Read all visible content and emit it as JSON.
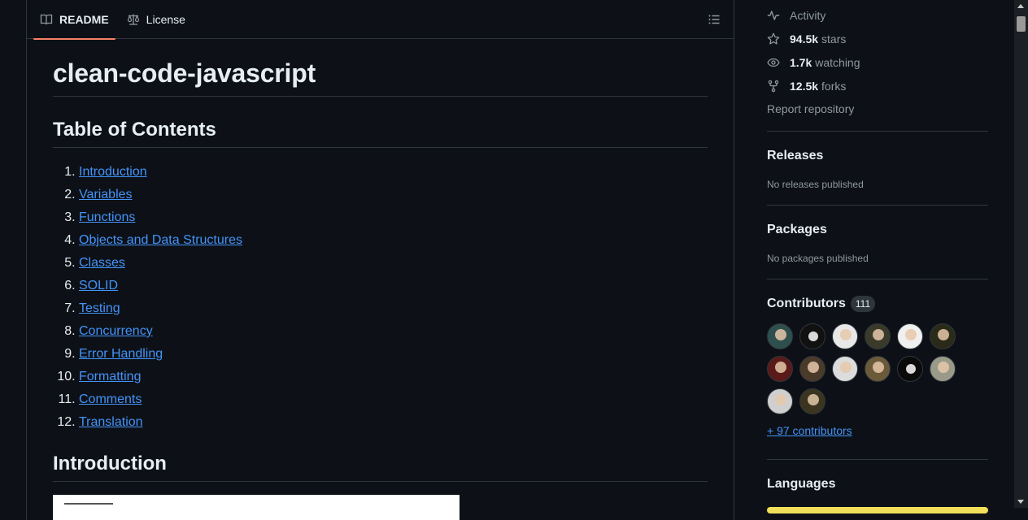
{
  "colors": {
    "background": "#0d1117",
    "border": "#30363d",
    "link": "#4493f8",
    "muted": "#9198a1",
    "active_tab_underline": "#f78166",
    "language_bar": "#f1e05a"
  },
  "readme": {
    "tabs": [
      {
        "label": "README",
        "icon": "book-icon",
        "active": true
      },
      {
        "label": "License",
        "icon": "law-icon",
        "active": false
      }
    ],
    "outline_icon": "list-unordered-icon",
    "title": "clean-code-javascript",
    "toc_heading": "Table of Contents",
    "toc": [
      "Introduction",
      "Variables",
      "Functions",
      "Objects and Data Structures",
      "Classes",
      "SOLID",
      "Testing",
      "Concurrency",
      "Error Handling",
      "Formatting",
      "Comments",
      "Translation"
    ],
    "intro_heading": "Introduction"
  },
  "sidebar": {
    "stats": [
      {
        "icon": "pulse-icon",
        "value": "",
        "label": "Activity"
      },
      {
        "icon": "star-icon",
        "value": "94.5k",
        "label": "stars"
      },
      {
        "icon": "eye-icon",
        "value": "1.7k",
        "label": "watching"
      },
      {
        "icon": "fork-icon",
        "value": "12.5k",
        "label": "forks"
      }
    ],
    "report": "Report repository",
    "releases": {
      "heading": "Releases",
      "note": "No releases published"
    },
    "packages": {
      "heading": "Packages",
      "note": "No packages published"
    },
    "contributors": {
      "heading": "Contributors",
      "count": "111",
      "avatar_colors": [
        "#2f4f4f",
        "#111111",
        "#e8e8e8",
        "#3a3a2a",
        "#f0f0f0",
        "#2a2a18",
        "#5a1a1a",
        "#4a3a2a",
        "#dcdcdc",
        "#6b5a3a",
        "#0a0a0a",
        "#9a9a8a",
        "#cfcfcf",
        "#3b3520"
      ],
      "more": "+ 97 contributors"
    },
    "languages": {
      "heading": "Languages"
    }
  }
}
